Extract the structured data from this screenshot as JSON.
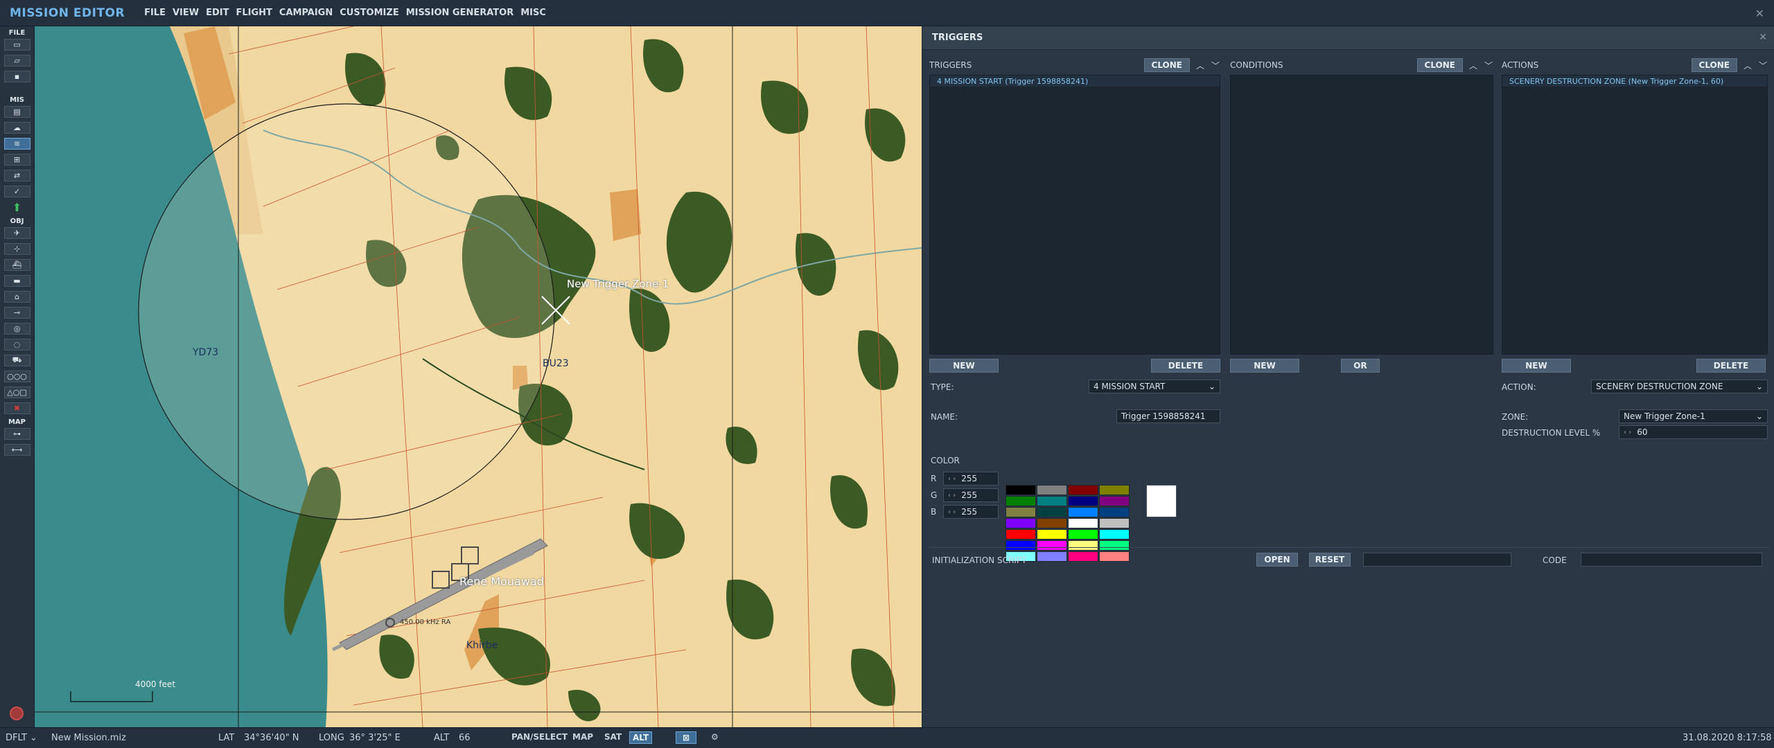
{
  "app": {
    "title": "MISSION EDITOR",
    "close_glyph": "✕"
  },
  "menu": [
    "FILE",
    "VIEW",
    "EDIT",
    "FLIGHT",
    "CAMPAIGN",
    "CUSTOMIZE",
    "MISSION GENERATOR",
    "MISC"
  ],
  "toolbar": {
    "file_label": "FILE",
    "mis_label": "MIS",
    "obj_label": "OBJ",
    "map_label": "MAP"
  },
  "map": {
    "labels": {
      "grid_west": "YD73",
      "grid_center": "BU23",
      "trigger_zone": "New Trigger Zone-1",
      "airfield": "Rene Mouawad",
      "town": "Khirbe",
      "navaid": "450.00 kHz RA",
      "scale": "4000 feet"
    }
  },
  "panel": {
    "title": "TRIGGERS",
    "close_glyph": "✕",
    "triggers": {
      "label": "TRIGGERS",
      "clone": "CLONE",
      "items": [
        "4 MISSION START (Trigger 1598858241)"
      ],
      "new": "NEW",
      "delete": "DELETE"
    },
    "conditions": {
      "label": "CONDITIONS",
      "clone": "CLONE",
      "new": "NEW",
      "or": "OR"
    },
    "actions": {
      "label": "ACTIONS",
      "clone": "CLONE",
      "items": [
        "SCENERY DESTRUCTION ZONE (New Trigger Zone-1, 60)"
      ],
      "new": "NEW",
      "delete": "DELETE"
    },
    "type_label": "TYPE:",
    "type_value": "4 MISSION START",
    "name_label": "NAME:",
    "name_value": "Trigger 1598858241",
    "color_label": "COLOR",
    "r_label": "R",
    "r_value": "255",
    "g_label": "G",
    "g_value": "255",
    "b_label": "B",
    "b_value": "255",
    "palette": [
      "#000000",
      "#808080",
      "#800000",
      "#808000",
      "#008000",
      "#008080",
      "#000080",
      "#800080",
      "#808040",
      "#004040",
      "#0080ff",
      "#004080",
      "#8000ff",
      "#804000",
      "#ffffff",
      "#c0c0c0",
      "#ff0000",
      "#ffff00",
      "#00ff00",
      "#00ffff",
      "#0000ff",
      "#ff00ff",
      "#ffff80",
      "#00ff80",
      "#80ffff",
      "#8080ff",
      "#ff0080",
      "#ff8080"
    ],
    "selected_color": "#ffffff",
    "action_label": "ACTION:",
    "action_value": "SCENERY DESTRUCTION ZONE",
    "zone_label": "ZONE:",
    "zone_value": "New Trigger Zone-1",
    "destruction_label": "DESTRUCTION LEVEL %",
    "destruction_value": "60",
    "init_script_label": "INITIALIZATION SCRIPT",
    "open": "OPEN",
    "reset": "RESET",
    "code_label": "CODE"
  },
  "status": {
    "mode": "DFLT",
    "file": "New Mission.miz",
    "lat_label": "LAT",
    "lat_value": "34°36'40\" N",
    "long_label": "LONG",
    "long_value": "36° 3'25\" E",
    "alt_label": "ALT",
    "alt_value": "66",
    "pan_select": "PAN/SELECT",
    "map_btn": "MAP",
    "sat_btn": "SAT",
    "alt_btn": "ALT",
    "datetime": "31.08.2020 8:17:58"
  }
}
